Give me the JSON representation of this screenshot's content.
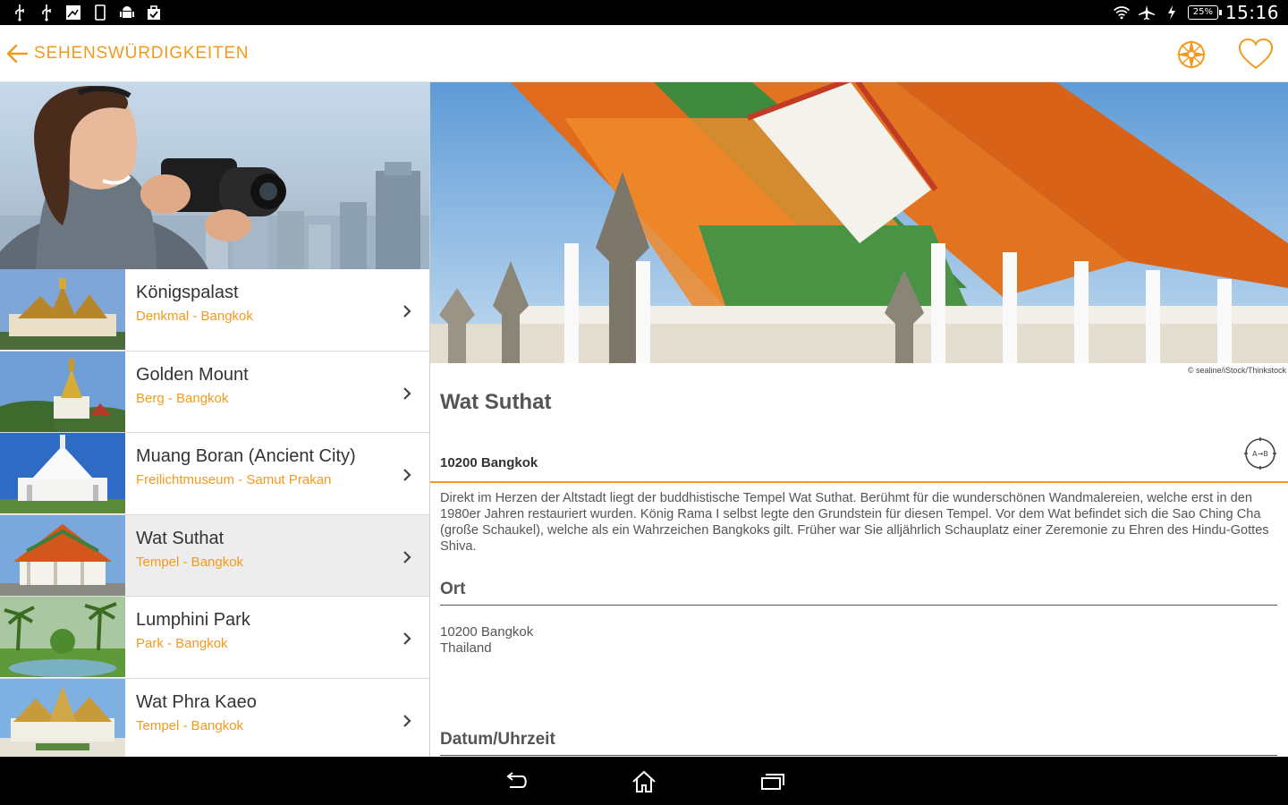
{
  "status_bar": {
    "time": "15:16",
    "battery": "25%",
    "left_icons": [
      "usb-icon",
      "usb-debug-icon",
      "gallery-icon",
      "phone-icon",
      "android-icon",
      "bag-icon"
    ],
    "right_icons": [
      "wifi-icon",
      "airplane-icon",
      "charging-icon"
    ]
  },
  "action_bar": {
    "title": "SEHENSWÜRDIGKEITEN",
    "accent_color": "#f39a1e"
  },
  "list": {
    "items": [
      {
        "title": "Königspalast",
        "subtitle": "Denkmal - Bangkok",
        "selected": false
      },
      {
        "title": "Golden Mount",
        "subtitle": "Berg - Bangkok",
        "selected": false
      },
      {
        "title": "Muang Boran (Ancient City)",
        "subtitle": "Freilichtmuseum - Samut Prakan",
        "selected": false
      },
      {
        "title": "Wat Suthat",
        "subtitle": "Tempel - Bangkok",
        "selected": true
      },
      {
        "title": "Lumphini Park",
        "subtitle": "Park - Bangkok",
        "selected": false
      },
      {
        "title": "Wat Phra Kaeo",
        "subtitle": "Tempel - Bangkok",
        "selected": false
      }
    ]
  },
  "detail": {
    "image_credit": "© sealine/iStock/Thinkstock",
    "title": "Wat Suthat",
    "address_line": "10200 Bangkok",
    "route_button_label": "A→B",
    "description": "Direkt im Herzen der Altstadt liegt der buddhistische Tempel Wat Suthat. Berühmt für die wunderschönen Wandmalereien, welche erst in den 1980er Jahren restauriert wurden. König Rama I selbst legte den Grundstein für diesen Tempel. Vor dem Wat befindet sich die Sao Ching Cha (große Schaukel), welche als ein Wahrzeichen Bangkoks gilt. Früher war Sie alljährlich Schauplatz einer Zeremonie zu Ehren des Hindu-Gottes Shiva.",
    "ort_heading": "Ort",
    "ort_lines": [
      "10200 Bangkok",
      "Thailand"
    ],
    "datum_heading": "Datum/Uhrzeit"
  },
  "nav_bar": {
    "buttons": [
      "back-icon",
      "home-icon",
      "recent-apps-icon"
    ]
  }
}
